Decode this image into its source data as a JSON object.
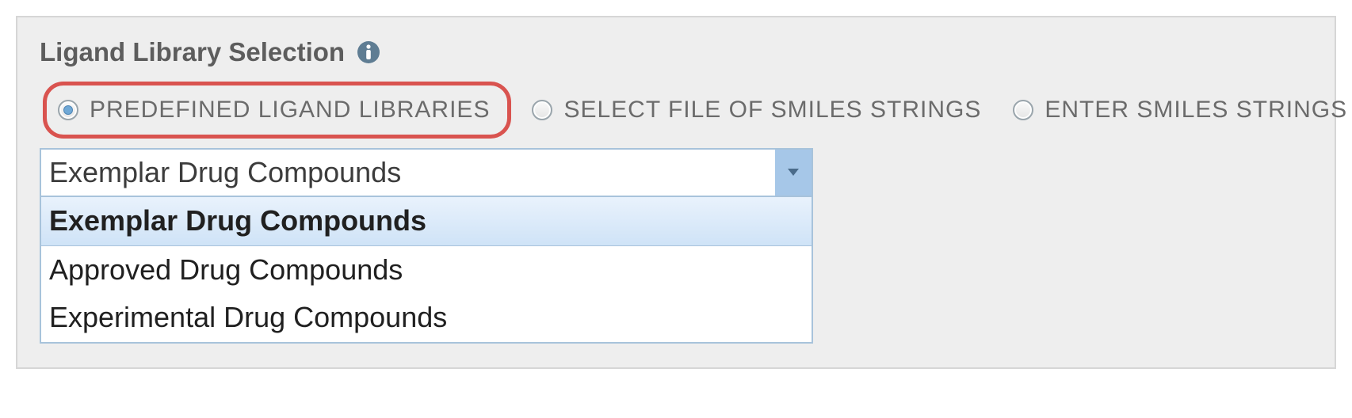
{
  "section": {
    "title": "Ligand Library Selection"
  },
  "radios": {
    "predefined": {
      "label": "PREDEFINED LIGAND LIBRARIES",
      "checked": true
    },
    "select_file": {
      "label": "SELECT FILE OF SMILES STRINGS",
      "checked": false
    },
    "enter_smiles": {
      "label": "ENTER SMILES STRINGS",
      "checked": false
    }
  },
  "dropdown": {
    "value": "Exemplar Drug Compounds",
    "options": {
      "opt0": {
        "label": "Exemplar Drug Compounds",
        "selected": true
      },
      "opt1": {
        "label": "Approved Drug Compounds",
        "selected": false
      },
      "opt2": {
        "label": "Experimental Drug Compounds",
        "selected": false
      }
    }
  },
  "colors": {
    "highlight_ring": "#d9534f",
    "panel_bg": "#eeeeee",
    "accent_blue": "#a6c7e8"
  }
}
